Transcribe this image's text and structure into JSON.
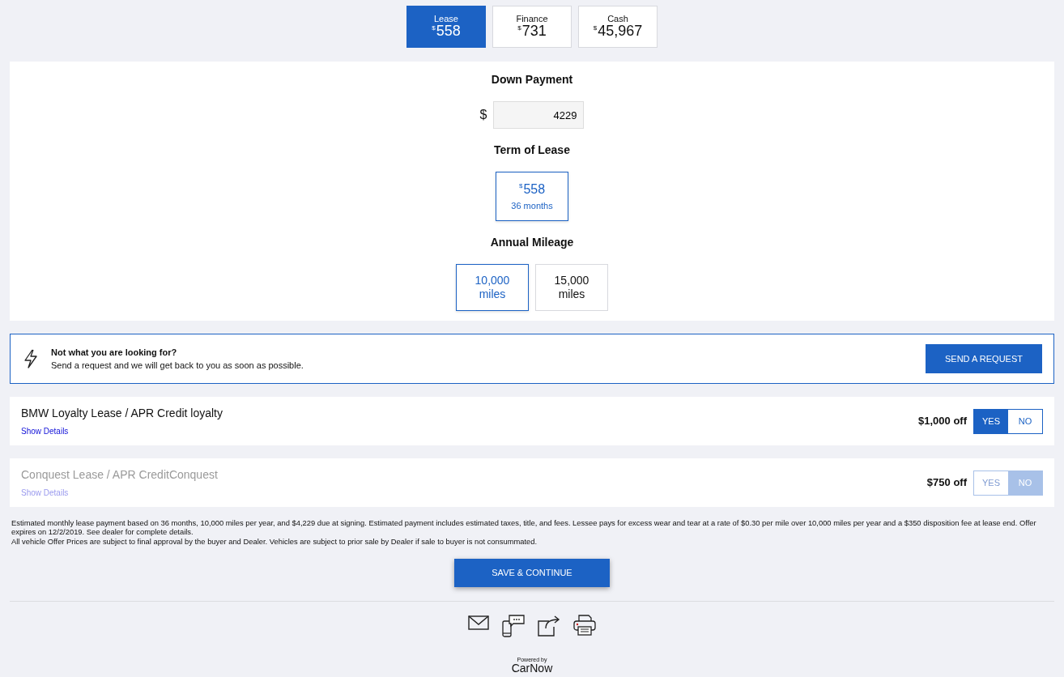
{
  "payment_tabs": [
    {
      "label": "Lease",
      "currency": "$",
      "amount": "558",
      "selected": true
    },
    {
      "label": "Finance",
      "currency": "$",
      "amount": "731",
      "selected": false
    },
    {
      "label": "Cash",
      "currency": "$",
      "amount": "45,967",
      "selected": false
    }
  ],
  "down_payment": {
    "title": "Down Payment",
    "currency": "$",
    "value": "4229"
  },
  "term": {
    "title": "Term of Lease",
    "options": [
      {
        "currency": "$",
        "amount": "558",
        "months": "36 months",
        "selected": true
      }
    ]
  },
  "mileage": {
    "title": "Annual Mileage",
    "options": [
      {
        "amount": "10,000",
        "unit": "miles",
        "selected": true
      },
      {
        "amount": "15,000",
        "unit": "miles",
        "selected": false
      }
    ]
  },
  "request_banner": {
    "title": "Not what you are looking for?",
    "text": "Send a request and we will get back to you as soon as possible.",
    "button": "SEND A REQUEST"
  },
  "incentives": [
    {
      "name": "BMW Loyalty Lease / APR Credit loyalty",
      "link": "Show Details",
      "discount": "$1,000 off",
      "disabled": false,
      "options": [
        {
          "label": "YES",
          "selected": true
        },
        {
          "label": "NO",
          "selected": false
        }
      ]
    },
    {
      "name": "Conquest Lease / APR CreditConquest",
      "link": "Show Details",
      "discount": "$750 off",
      "disabled": true,
      "options": [
        {
          "label": "YES",
          "selected": false
        },
        {
          "label": "NO",
          "selected": true
        }
      ]
    }
  ],
  "disclaimer": [
    "Estimated monthly lease payment based on 36 months, 10,000 miles per year, and $4,229 due at signing. Estimated payment includes estimated taxes, title, and fees. Lessee pays for excess wear and tear at a rate of $0.30 per mile over 10,000 miles per year and a $350 disposition fee at lease end. Offer expires on 12/2/2019. See dealer for complete details.",
    "All vehicle Offer Prices are subject to final approval by the buyer and Dealer. Vehicles are subject to prior sale by Dealer if sale to buyer is not consummated."
  ],
  "save_button": "SAVE & CONTINUE",
  "powered_by": {
    "prefix": "Powered by",
    "brand": "CarNow"
  }
}
